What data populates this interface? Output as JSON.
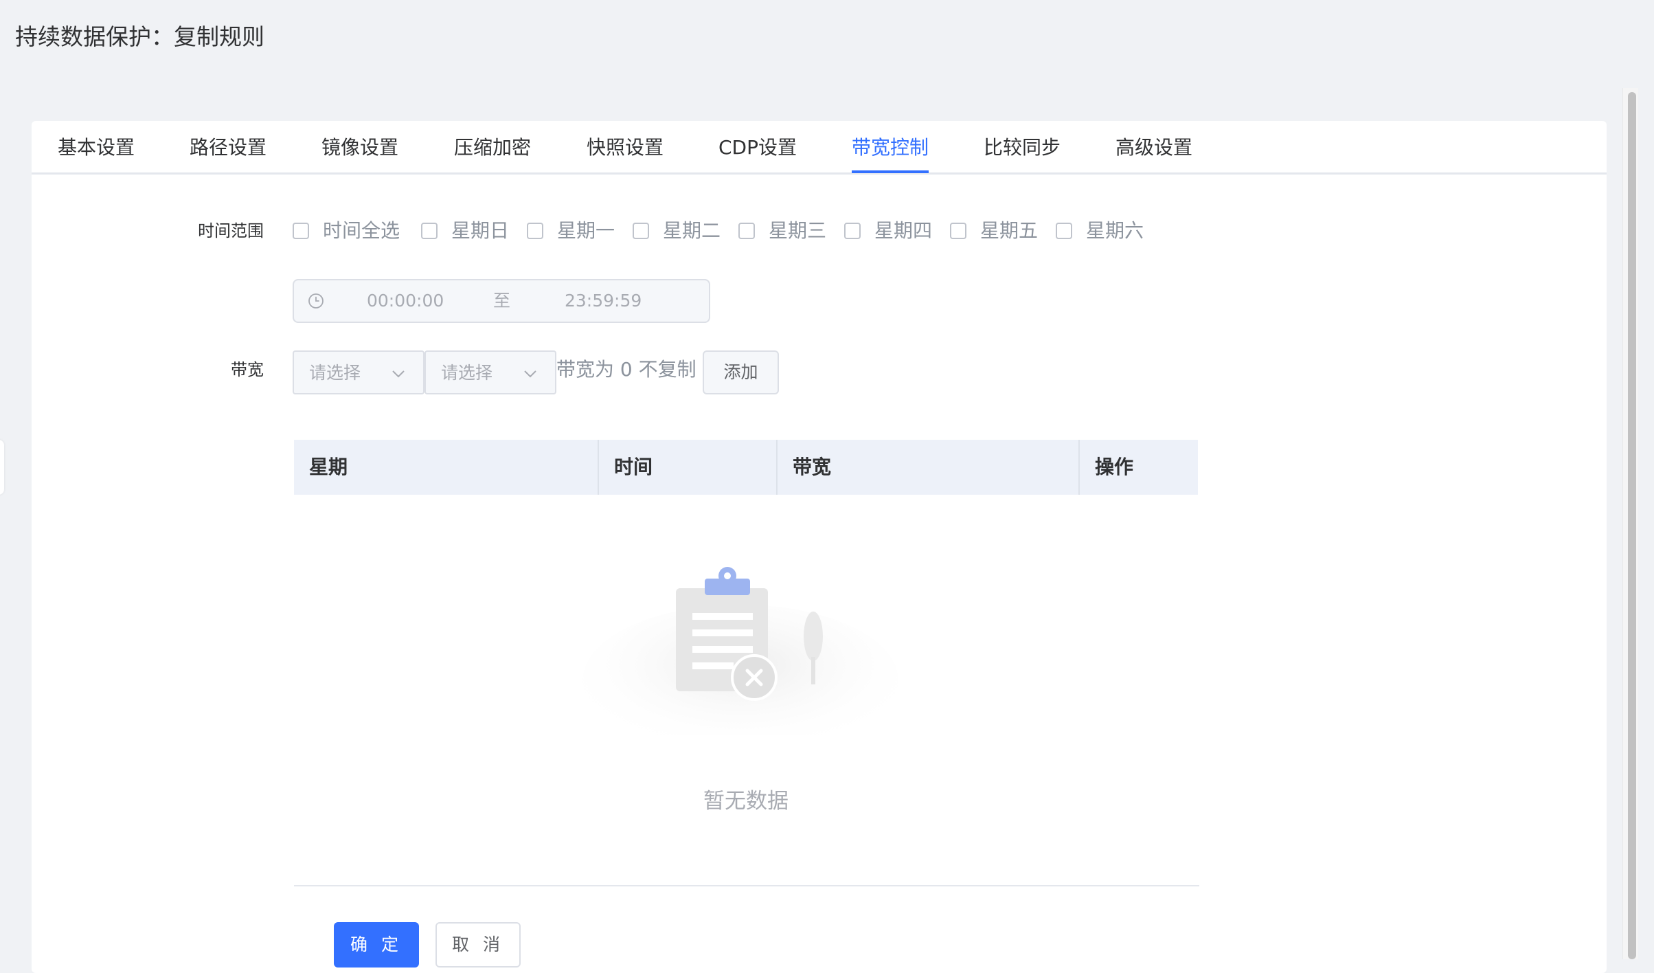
{
  "page": {
    "title": "持续数据保护：复制规则"
  },
  "tabs": [
    {
      "label": "基本设置"
    },
    {
      "label": "路径设置"
    },
    {
      "label": "镜像设置"
    },
    {
      "label": "压缩加密"
    },
    {
      "label": "快照设置"
    },
    {
      "label": "CDP设置"
    },
    {
      "label": "带宽控制",
      "active": true
    },
    {
      "label": "比较同步"
    },
    {
      "label": "高级设置"
    }
  ],
  "form": {
    "time_range_label": "时间范围",
    "days": [
      {
        "label": "时间全选",
        "checked": false
      },
      {
        "label": "星期日",
        "checked": false
      },
      {
        "label": "星期一",
        "checked": false
      },
      {
        "label": "星期二",
        "checked": false
      },
      {
        "label": "星期三",
        "checked": false
      },
      {
        "label": "星期四",
        "checked": false
      },
      {
        "label": "星期五",
        "checked": false
      },
      {
        "label": "星期六",
        "checked": false
      }
    ],
    "time_picker": {
      "start": "00:00:00",
      "separator": "至",
      "end": "23:59:59"
    },
    "bandwidth_label": "带宽",
    "select1_placeholder": "请选择",
    "select2_placeholder": "请选择",
    "hint": "带宽为 0 不复制",
    "add_button": "添加"
  },
  "table": {
    "columns": [
      "星期",
      "时间",
      "带宽",
      "操作"
    ],
    "rows": [],
    "empty_text": "暂无数据"
  },
  "footer": {
    "confirm": "确 定",
    "cancel": "取 消"
  },
  "colors": {
    "accent": "#3370ff",
    "background": "#f0f2f5",
    "table_header": "#edf1f9"
  }
}
